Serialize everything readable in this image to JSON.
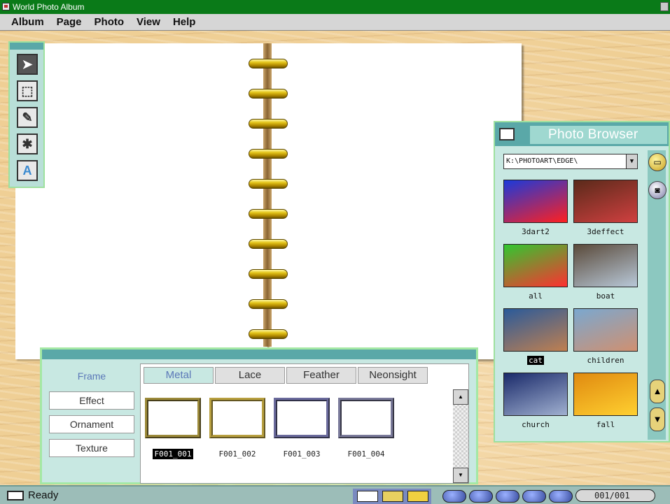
{
  "app": {
    "title": "World Photo Album"
  },
  "menu": [
    "Album",
    "Page",
    "Photo",
    "View",
    "Help"
  ],
  "tools": [
    {
      "icon": "arrow-pointer-icon",
      "glyph": "➤"
    },
    {
      "icon": "crop-icon",
      "glyph": "⬚"
    },
    {
      "icon": "pencil-icon",
      "glyph": "✎"
    },
    {
      "icon": "stamp-icon",
      "glyph": "✱"
    },
    {
      "icon": "text-tool-icon",
      "glyph": "A"
    }
  ],
  "photo_browser": {
    "title": "Photo Browser",
    "folder": "K:\\PHOTOART\\EDGE\\",
    "thumbnails": [
      {
        "caption": "3dart2",
        "colors": [
          "#1a3adb",
          "#ff2020"
        ]
      },
      {
        "caption": "3deffect",
        "colors": [
          "#5a2a1a",
          "#d04040"
        ]
      },
      {
        "caption": "all",
        "colors": [
          "#30c830",
          "#ff3030"
        ]
      },
      {
        "caption": "boat",
        "colors": [
          "#5a4a3a",
          "#b8c8d8"
        ]
      },
      {
        "caption": "cat",
        "colors": [
          "#2a5a9a",
          "#c08050"
        ]
      },
      {
        "caption": "children",
        "colors": [
          "#7aa8d0",
          "#d09070"
        ]
      },
      {
        "caption": "church",
        "colors": [
          "#1a2a6a",
          "#a0b0d0"
        ]
      },
      {
        "caption": "fall",
        "colors": [
          "#e08a10",
          "#ffd030"
        ]
      }
    ],
    "selected_thumbnail": "cat"
  },
  "frame_panel": {
    "categories": [
      "Frame",
      "Effect",
      "Ornament",
      "Texture"
    ],
    "active_category": "Frame",
    "subtabs": [
      "Metal",
      "Lace",
      "Feather",
      "Neonsight"
    ],
    "active_subtab": "Metal",
    "frames": [
      {
        "caption": "F001_001",
        "color": "#9c8a3a"
      },
      {
        "caption": "F001_002",
        "color": "#b8a040"
      },
      {
        "caption": "F001_003",
        "color": "#6a6a9c"
      },
      {
        "caption": "F001_004",
        "color": "#7a7a9a"
      }
    ],
    "selected_frame": "F001_001"
  },
  "status": {
    "text": "Ready",
    "counter": "001/001"
  }
}
